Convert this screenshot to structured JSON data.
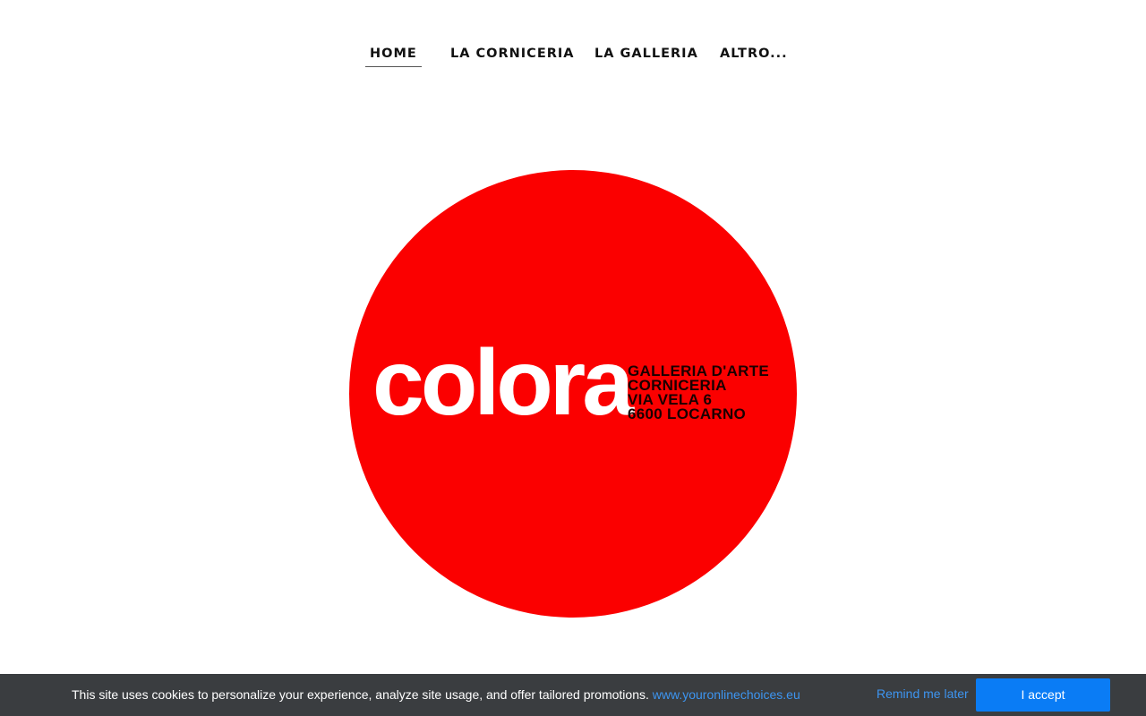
{
  "nav": {
    "items": [
      {
        "label": "HOME",
        "active": true
      },
      {
        "label": "LA CORNICERIA",
        "active": false
      },
      {
        "label": "LA GALLERIA",
        "active": false
      },
      {
        "label": "ALTRO..."
      }
    ]
  },
  "logo": {
    "word": "colora",
    "lines": [
      "GALLERIA D'ARTE",
      "CORNICERIA",
      "VIA VELA 6",
      "6600 LOCARNO"
    ],
    "circle_color": "#fb0000"
  },
  "cookie": {
    "text": "This site uses cookies to personalize your experience, analyze site usage, and offer tailored promotions. ",
    "link": "www.youronlinechoices.eu",
    "remind_label": "Remind me later",
    "accept_label": "I accept",
    "bar_color": "#3a3d40",
    "accent_color": "#0a7cf5"
  }
}
